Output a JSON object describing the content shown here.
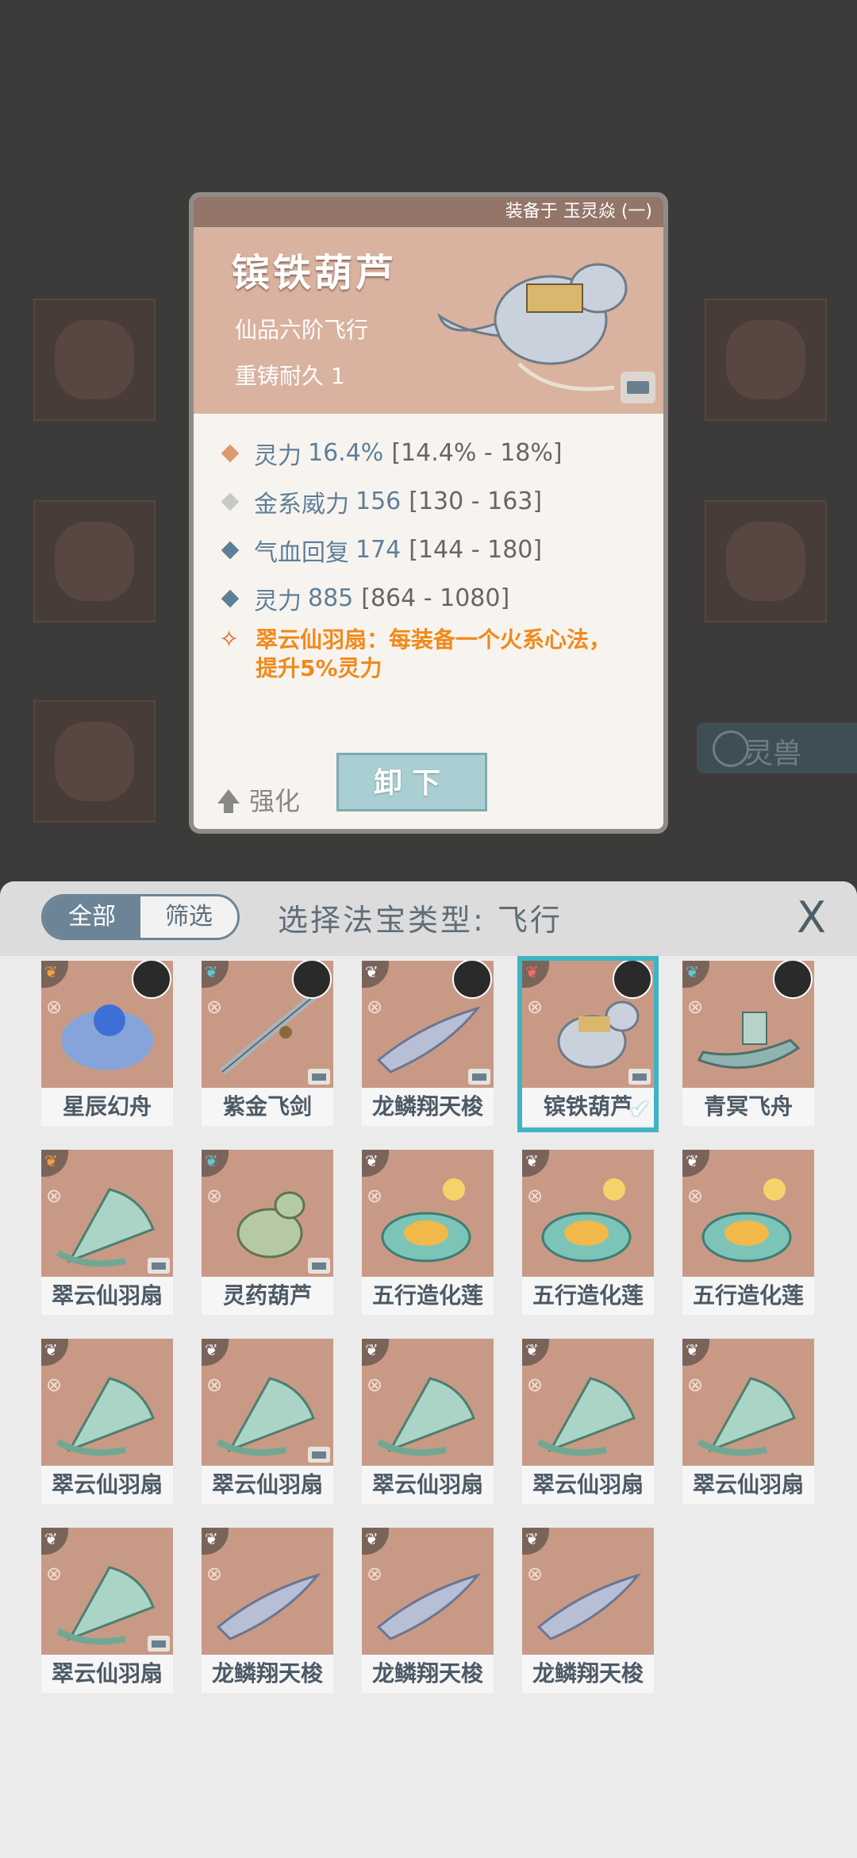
{
  "detail": {
    "equipped_on": "装备于 玉灵焱 (一)",
    "name": "镔铁葫芦",
    "grade": "仙品六阶飞行",
    "recast": "重铸耐久 1",
    "stats": [
      {
        "name": "灵力",
        "value": "16.4%",
        "range": "[14.4% - 18%]",
        "diamond_color": "#d99a6c"
      },
      {
        "name": "金系威力",
        "value": "156",
        "range": "[130 - 163]",
        "diamond_color": "#c8c8c8"
      },
      {
        "name": "气血回复",
        "value": "174",
        "range": "[144 - 180]",
        "diamond_color": "#5f7f98"
      },
      {
        "name": "灵力",
        "value": "885",
        "range": "[864 - 1080]",
        "diamond_color": "#5f7f98"
      }
    ],
    "set_bonus_line1": "翠云仙羽扇：每装备一个火系心法，",
    "set_bonus_line2": "提升5%灵力",
    "enhance_label": "强化",
    "unequip_label": "卸下"
  },
  "background_pet_tab": "灵兽",
  "panel": {
    "tab_all": "全部",
    "tab_filter": "筛选",
    "title": "选择法宝类型: 飞行",
    "close": "X"
  },
  "items": [
    {
      "label": "星辰幻舟",
      "wing": "#f0a040",
      "avatar": true,
      "box": false,
      "selected": false,
      "art": "boat-blue"
    },
    {
      "label": "紫金飞剑",
      "wing": "#5fc8d0",
      "avatar": true,
      "box": true,
      "selected": false,
      "art": "sword"
    },
    {
      "label": "龙鳞翔天梭",
      "wing": "#ffffff",
      "avatar": true,
      "box": true,
      "selected": false,
      "art": "shuttle"
    },
    {
      "label": "镔铁葫芦",
      "wing": "#f07060",
      "avatar": true,
      "box": true,
      "selected": true,
      "art": "gourd"
    },
    {
      "label": "青冥飞舟",
      "wing": "#5fc8d0",
      "avatar": true,
      "box": false,
      "selected": false,
      "art": "boat-green"
    },
    {
      "label": "翠云仙羽扇",
      "wing": "#f0a040",
      "avatar": false,
      "box": true,
      "selected": false,
      "art": "fan"
    },
    {
      "label": "灵药葫芦",
      "wing": "#5fc8d0",
      "avatar": false,
      "box": true,
      "selected": false,
      "art": "gourd-green"
    },
    {
      "label": "五行造化莲",
      "wing": "#ffffff",
      "avatar": false,
      "box": false,
      "selected": false,
      "art": "lotus"
    },
    {
      "label": "五行造化莲",
      "wing": "#ffffff",
      "avatar": false,
      "box": false,
      "selected": false,
      "art": "lotus"
    },
    {
      "label": "五行造化莲",
      "wing": "#ffffff",
      "avatar": false,
      "box": false,
      "selected": false,
      "art": "lotus"
    },
    {
      "label": "翠云仙羽扇",
      "wing": "#ffffff",
      "avatar": false,
      "box": false,
      "selected": false,
      "art": "fan"
    },
    {
      "label": "翠云仙羽扇",
      "wing": "#ffffff",
      "avatar": false,
      "box": true,
      "selected": false,
      "art": "fan"
    },
    {
      "label": "翠云仙羽扇",
      "wing": "#ffffff",
      "avatar": false,
      "box": false,
      "selected": false,
      "art": "fan"
    },
    {
      "label": "翠云仙羽扇",
      "wing": "#ffffff",
      "avatar": false,
      "box": false,
      "selected": false,
      "art": "fan"
    },
    {
      "label": "翠云仙羽扇",
      "wing": "#ffffff",
      "avatar": false,
      "box": false,
      "selected": false,
      "art": "fan"
    },
    {
      "label": "翠云仙羽扇",
      "wing": "#ffffff",
      "avatar": false,
      "box": true,
      "selected": false,
      "art": "fan"
    },
    {
      "label": "龙鳞翔天梭",
      "wing": "#ffffff",
      "avatar": false,
      "box": false,
      "selected": false,
      "art": "shuttle"
    },
    {
      "label": "龙鳞翔天梭",
      "wing": "#ffffff",
      "avatar": false,
      "box": false,
      "selected": false,
      "art": "shuttle"
    },
    {
      "label": "龙鳞翔天梭",
      "wing": "#ffffff",
      "avatar": false,
      "box": false,
      "selected": false,
      "art": "shuttle"
    }
  ]
}
